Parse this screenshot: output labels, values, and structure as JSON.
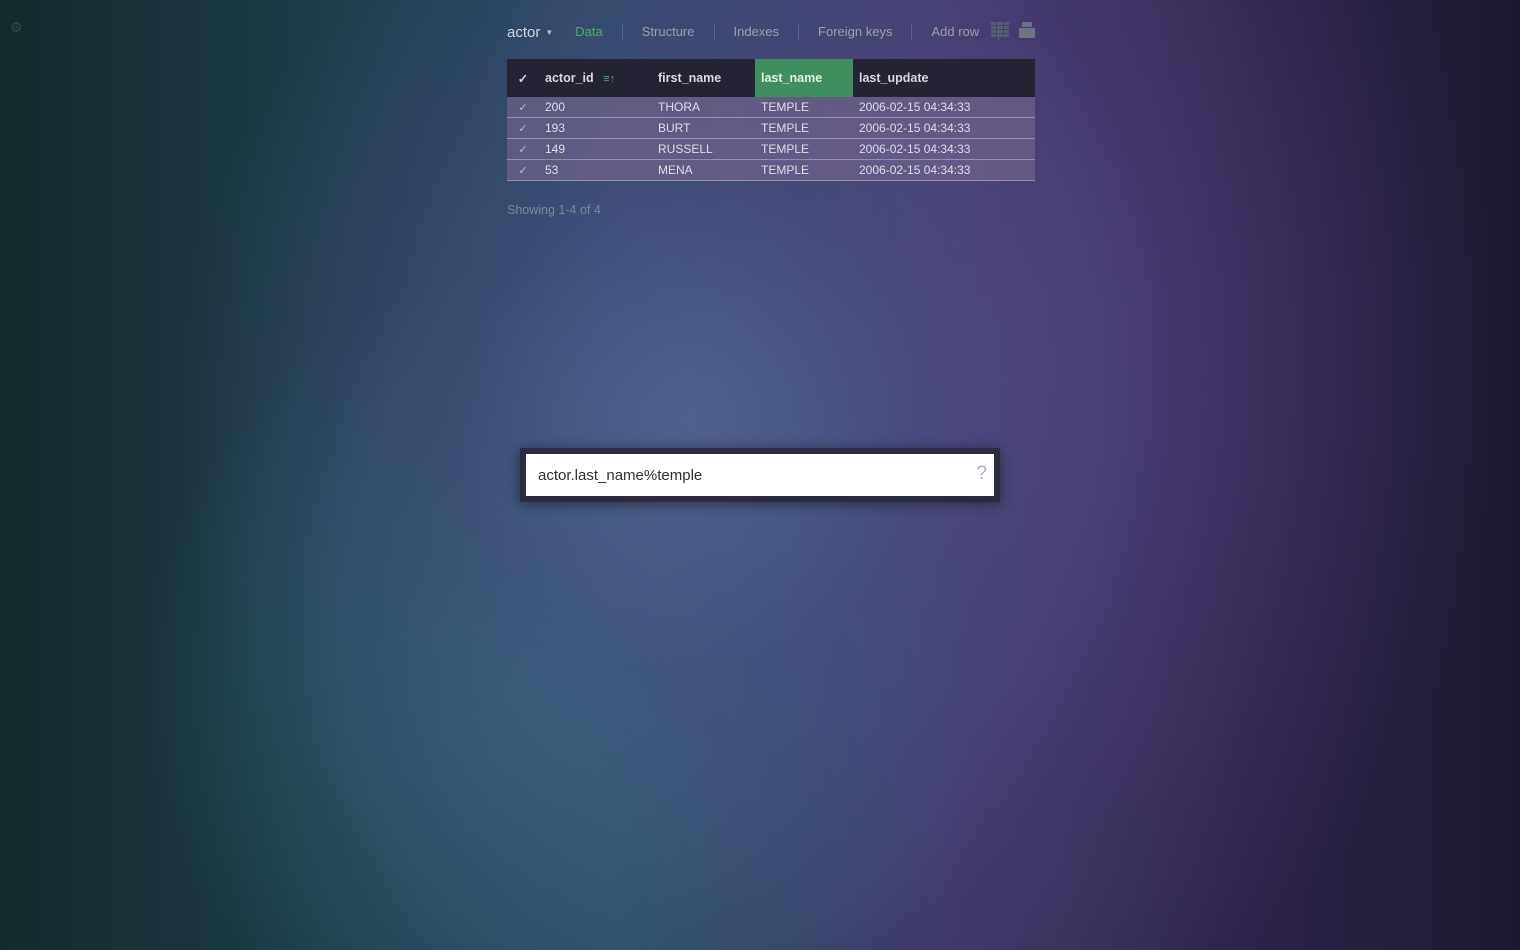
{
  "app": {
    "settings_icon": "gear-icon"
  },
  "toolbar": {
    "table_name": "actor",
    "tabs": [
      {
        "label": "Data",
        "active": true
      },
      {
        "label": "Structure",
        "active": false
      },
      {
        "label": "Indexes",
        "active": false
      },
      {
        "label": "Foreign keys",
        "active": false
      },
      {
        "label": "Add row",
        "active": false
      }
    ],
    "view_icons": [
      "grid-view-icon",
      "stack-view-icon"
    ]
  },
  "table": {
    "columns": [
      {
        "label": "actor_id",
        "sorted": "ascending"
      },
      {
        "label": "first_name"
      },
      {
        "label": "last_name",
        "selected": true
      },
      {
        "label": "last_update"
      }
    ],
    "rows": [
      {
        "actor_id": "200",
        "first_name": "THORA",
        "last_name": "TEMPLE",
        "last_update": "2006-02-15 04:34:33"
      },
      {
        "actor_id": "193",
        "first_name": "BURT",
        "last_name": "TEMPLE",
        "last_update": "2006-02-15 04:34:33"
      },
      {
        "actor_id": "149",
        "first_name": "RUSSELL",
        "last_name": "TEMPLE",
        "last_update": "2006-02-15 04:34:33"
      },
      {
        "actor_id": "53",
        "first_name": "MENA",
        "last_name": "TEMPLE",
        "last_update": "2006-02-15 04:34:33"
      }
    ]
  },
  "pagination": {
    "text": "Showing 1-4 of 4"
  },
  "search": {
    "value": "actor.last_name%temple",
    "help": "?"
  },
  "colors": {
    "accent": "#4fae6e",
    "selected_column": "#3f8f5e",
    "header_bg": "#242333"
  }
}
